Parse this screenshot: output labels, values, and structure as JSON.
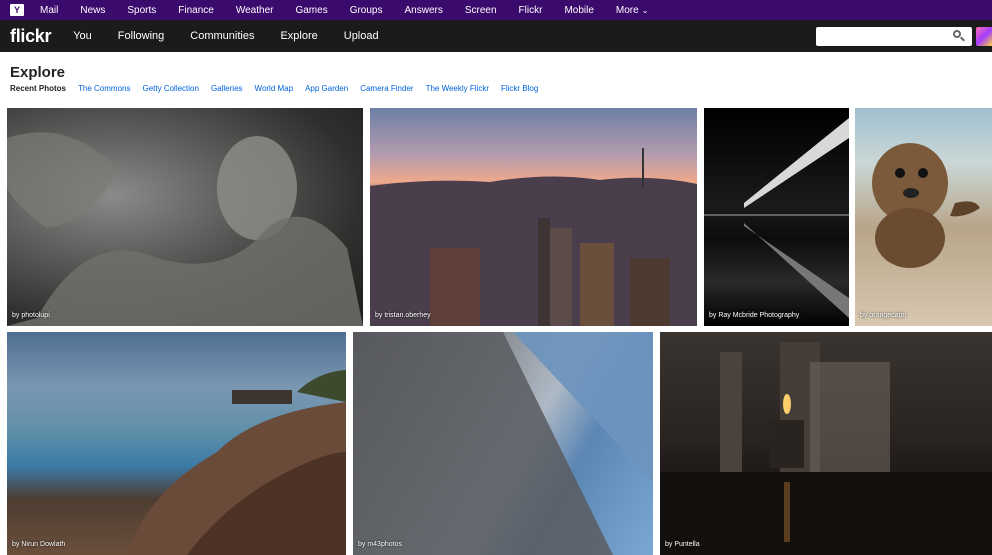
{
  "yahoo_bar": {
    "logo": "Y",
    "links": [
      "Mail",
      "News",
      "Sports",
      "Finance",
      "Weather",
      "Games",
      "Groups",
      "Answers",
      "Screen",
      "Flickr",
      "Mobile",
      "More"
    ],
    "more_caret": "⌄"
  },
  "flickr_nav": {
    "logo": "flickr",
    "links": [
      "You",
      "Following",
      "Communities",
      "Explore",
      "Upload"
    ],
    "search": {
      "value": "",
      "placeholder": ""
    }
  },
  "explore": {
    "title": "Explore",
    "tabs": [
      "Recent Photos",
      "The Commons",
      "Getty Collection",
      "Galleries",
      "World Map",
      "App Garden",
      "Camera Finder",
      "The Weekly Flickr",
      "Flickr Blog"
    ],
    "active_tab": "Recent Photos"
  },
  "photos": [
    {
      "caption": "by photolupi"
    },
    {
      "caption": "by tristan.oberhey"
    },
    {
      "caption": "by Ray Mcbride Photography"
    },
    {
      "caption": "by orangecapri"
    },
    {
      "caption": "by Nirun Dowlath"
    },
    {
      "caption": "by m43photos"
    },
    {
      "caption": "by Puntella"
    }
  ],
  "colors": {
    "yahoo_purple": "#3b0a6d",
    "flickr_nav": "#1b1b1b",
    "link_blue": "#0063dc"
  }
}
